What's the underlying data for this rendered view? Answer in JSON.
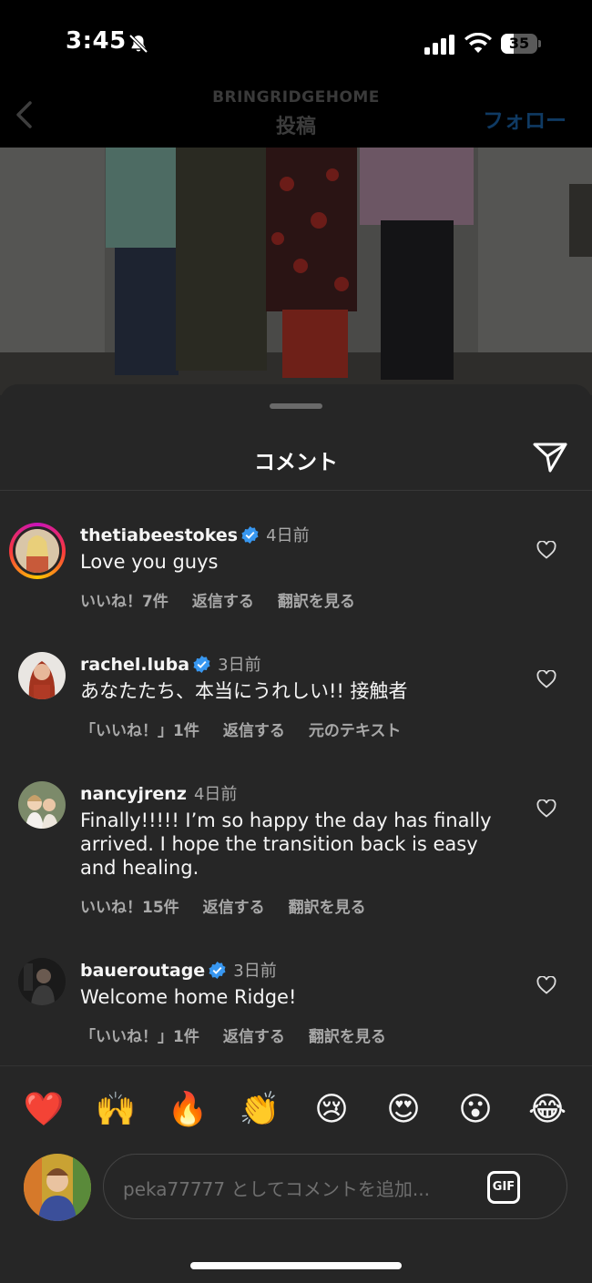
{
  "status_bar": {
    "time": "3:45",
    "battery_level": "35",
    "battery_fraction": 0.35
  },
  "header": {
    "account": "BRINGRIDGEHOME",
    "title": "投稿",
    "follow_label": "フォロー"
  },
  "sheet": {
    "title": "コメント"
  },
  "comments": [
    {
      "username": "thetiabeestokes",
      "verified": true,
      "time": "4日前",
      "text": "Love you guys",
      "likes": "いいね！7件",
      "reply": "返信する",
      "translate": "翻訳を見る"
    },
    {
      "username": "rachel.luba",
      "verified": true,
      "time": "3日前",
      "text": "あなたたち、本当にうれしい!! 接触者",
      "likes": "「いいね！」1件",
      "reply": "返信する",
      "translate": "元のテキスト"
    },
    {
      "username": "nancyjrenz",
      "verified": false,
      "time": "4日前",
      "text": "Finally!!!!! I’m so happy the day has finally arrived. I hope the transition back is easy and healing.",
      "likes": "いいね！15件",
      "reply": "返信する",
      "translate": "翻訳を見る"
    },
    {
      "username": "baueroutage",
      "verified": true,
      "time": "3日前",
      "text": "Welcome home Ridge!",
      "likes": "「いいね！」1件",
      "reply": "返信する",
      "translate": "翻訳を見る"
    }
  ],
  "emoji_reactions": [
    "❤️",
    "🙌",
    "🔥",
    "👏",
    "😢",
    "😍",
    "😮",
    "😂"
  ],
  "composer": {
    "placeholder": "peka77777 としてコメントを追加...",
    "gif_label": "GIF"
  },
  "icons": [
    "bell-muted-icon",
    "signal-icon",
    "wifi-icon",
    "battery-icon",
    "back-chevron-icon",
    "send-icon",
    "verified-icon",
    "heart-icon",
    "gif-icon"
  ]
}
